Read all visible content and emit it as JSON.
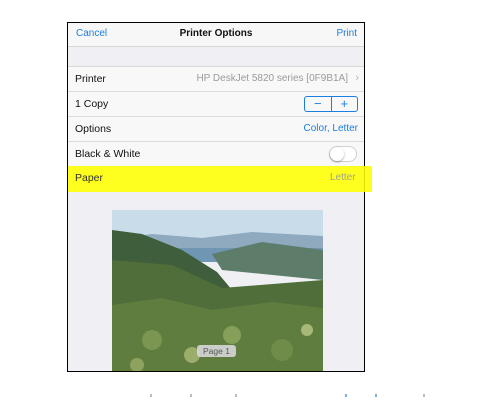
{
  "navbar": {
    "cancel_label": "Cancel",
    "title": "Printer Options",
    "print_label": "Print"
  },
  "rows": {
    "printer": {
      "label": "Printer",
      "value": "HP DeskJet 5820 series [0F9B1A]"
    },
    "copies": {
      "label": "1 Copy",
      "minus": "−",
      "plus": "+"
    },
    "options": {
      "label": "Options",
      "value": "Color, Letter"
    },
    "bw": {
      "label": "Black & White",
      "toggle_on": false
    },
    "paper": {
      "label": "Paper",
      "value": "Letter"
    }
  },
  "preview": {
    "page_badge": "Page 1"
  },
  "colors": {
    "accent": "#1a7fe0",
    "highlight": "#ffff00",
    "background": "#efeff4"
  }
}
